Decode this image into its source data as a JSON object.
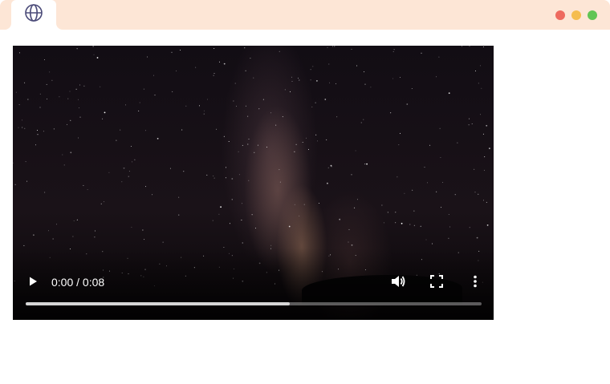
{
  "browser": {
    "tab_icon": "globe-icon",
    "window_controls": [
      {
        "name": "close",
        "color": "#ee6a5f"
      },
      {
        "name": "minimize",
        "color": "#f5bd4f"
      },
      {
        "name": "maximize",
        "color": "#61c554"
      }
    ],
    "titlebar_color": "#fde6d6"
  },
  "video_player": {
    "current_time": "0:00",
    "separator": " / ",
    "duration": "0:08",
    "buffered_fraction": 0.58,
    "icons": {
      "play": "play-icon",
      "volume": "volume-icon",
      "fullscreen": "fullscreen-icon",
      "more": "more-options-icon"
    }
  }
}
